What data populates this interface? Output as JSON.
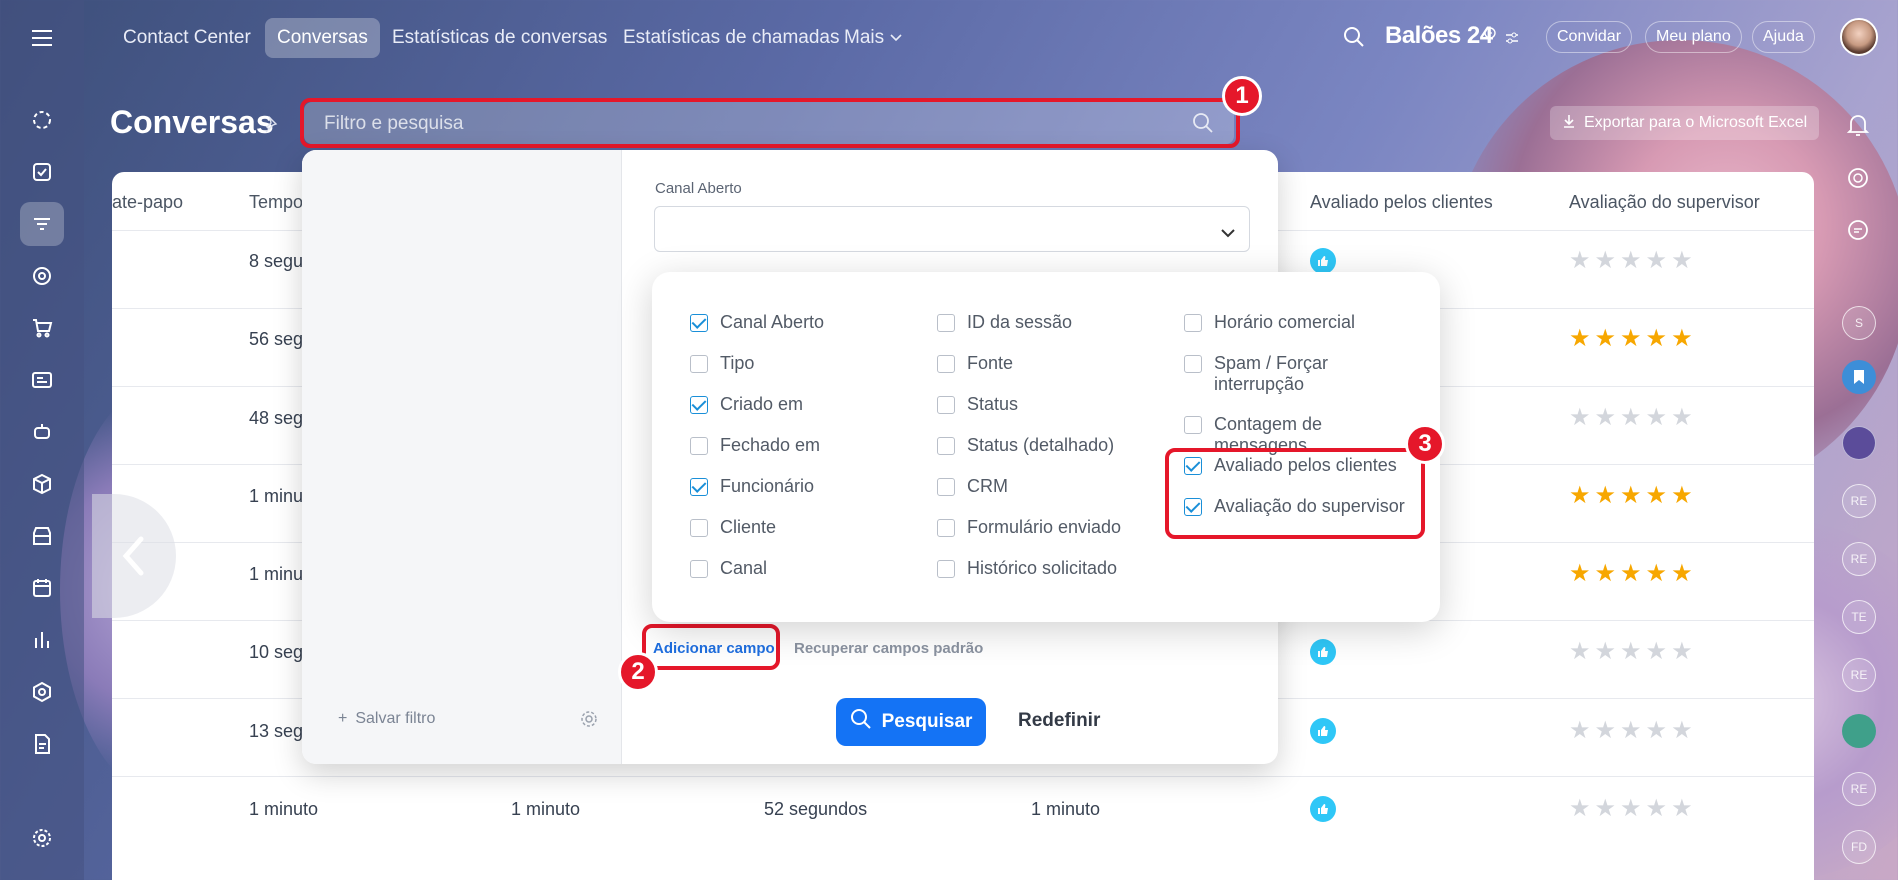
{
  "nav": {
    "items": [
      {
        "label": "Contact Center",
        "active": false
      },
      {
        "label": "Conversas",
        "active": true
      },
      {
        "label": "Estatísticas de conversas",
        "active": false
      },
      {
        "label": "Estatísticas de chamadas",
        "active": false
      },
      {
        "label": "Mais",
        "active": false
      }
    ],
    "brand": "Balões 24",
    "invite": "Convidar",
    "plan": "Meu plano",
    "help": "Ajuda"
  },
  "page": {
    "title": "Conversas",
    "search_placeholder": "Filtro e pesquisa",
    "export": "Exportar para o Microsoft Excel"
  },
  "table": {
    "headers": [
      "ate-papo",
      "Tempo",
      "Avaliado pelos clientes",
      "Avaliação do supervisor"
    ],
    "rows": [
      {
        "time": "8 segu",
        "cols": [
          "",
          "",
          ""
        ],
        "liked": true,
        "stars": 0
      },
      {
        "time": "56 segu",
        "cols": [
          "",
          "",
          ""
        ],
        "liked": false,
        "stars": 5
      },
      {
        "time": "48 segu",
        "cols": [
          "",
          "",
          ""
        ],
        "liked": false,
        "stars": 0
      },
      {
        "time": "1 minu",
        "cols": [
          "",
          "",
          ""
        ],
        "liked": false,
        "stars": 5
      },
      {
        "time": "1 minu",
        "cols": [
          "",
          "",
          ""
        ],
        "liked": false,
        "stars": 5
      },
      {
        "time": "10 segu",
        "cols": [
          "",
          "",
          ""
        ],
        "liked": true,
        "stars": 0
      },
      {
        "time": "13 segu",
        "cols": [
          "",
          "",
          ""
        ],
        "liked": true,
        "stars": 0
      },
      {
        "time": "1 minuto",
        "cols": [
          "1 minuto",
          "52 segundos",
          "1 minuto"
        ],
        "liked": true,
        "stars": 0
      }
    ]
  },
  "filter": {
    "field_label": "Canal Aberto",
    "add_field": "Adicionar campo",
    "restore_fields": "Recuperar campos padrão",
    "search": "Pesquisar",
    "reset": "Redefinir",
    "save_filter": "Salvar filtro"
  },
  "fields": {
    "col1": [
      {
        "label": "Canal Aberto",
        "checked": true
      },
      {
        "label": "Tipo",
        "checked": false
      },
      {
        "label": "Criado em",
        "checked": true
      },
      {
        "label": "Fechado em",
        "checked": false
      },
      {
        "label": "Funcionário",
        "checked": true
      },
      {
        "label": "Cliente",
        "checked": false
      },
      {
        "label": "Canal",
        "checked": false
      }
    ],
    "col2": [
      {
        "label": "ID da sessão",
        "checked": false
      },
      {
        "label": "Fonte",
        "checked": false
      },
      {
        "label": "Status",
        "checked": false
      },
      {
        "label": "Status (detalhado)",
        "checked": false
      },
      {
        "label": "CRM",
        "checked": false
      },
      {
        "label": "Formulário enviado",
        "checked": false
      },
      {
        "label": "Histórico solicitado",
        "checked": false
      }
    ],
    "col3": [
      {
        "label": "Horário comercial",
        "checked": false
      },
      {
        "label": "Spam / Forçar interrupção",
        "checked": false
      },
      {
        "label": "Contagem de mensagens",
        "checked": false
      },
      {
        "label": "Avaliado pelos clientes",
        "checked": true
      },
      {
        "label": "Avaliação do supervisor",
        "checked": true
      }
    ]
  },
  "callouts": [
    "1",
    "2",
    "3"
  ],
  "right_rail": [
    "S",
    "RE",
    "RE",
    "TE",
    "RE",
    "RE",
    "FD"
  ],
  "colors": {
    "accent": "#1473f5",
    "highlight": "#e5172a",
    "star": "#f7a700",
    "like": "#2fc7f7"
  }
}
